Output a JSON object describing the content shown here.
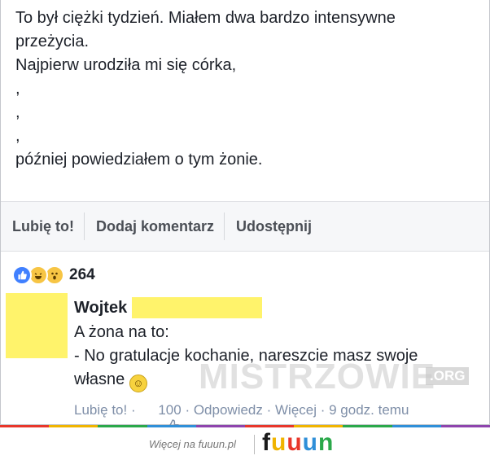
{
  "post": {
    "lines": [
      "To był ciężki tydzień. Miałem dwa bardzo intensywne",
      "przeżycia.",
      "Najpierw urodziła mi się córka,",
      ",",
      ",",
      ",",
      "później powiedziałem o tym żonie."
    ]
  },
  "actions": {
    "like": "Lubię to!",
    "comment": "Dodaj komentarz",
    "share": "Udostępnij"
  },
  "reactions": {
    "count": "264",
    "icons": [
      "like-reaction-icon",
      "haha-reaction-icon",
      "wow-reaction-icon"
    ]
  },
  "comment": {
    "author": "Wojtek",
    "lines": [
      "A żona na to:",
      "- No gratulacje kochanie, nareszcie masz swoje",
      "własne"
    ],
    "meta": {
      "like": "Lubię to!",
      "sep": " · ",
      "likes_count": "100",
      "reply": "Odpowiedz",
      "more": "Więcej",
      "time": "9 godz. temu"
    }
  },
  "watermark": {
    "text": "MISTRZOWIE",
    "suffix": ".ORG"
  },
  "footer": {
    "tagline": "Więcej na fuuun.pl",
    "logo": "fuuun",
    "logo_colors": [
      "#1a1a1a",
      "#f0b400",
      "#e8362a",
      "#2f8fd8",
      "#2aa84a"
    ],
    "strip_colors": [
      "#e8362a",
      "#f0b400",
      "#2aa84a",
      "#2f8fd8",
      "#8e44ad",
      "#e8362a",
      "#f0b400",
      "#2aa84a",
      "#2f8fd8",
      "#8e44ad"
    ]
  },
  "colors": {
    "redaction": "#fff36b",
    "meta_text": "#7f8fa8",
    "like_blue": "#4080ff"
  }
}
